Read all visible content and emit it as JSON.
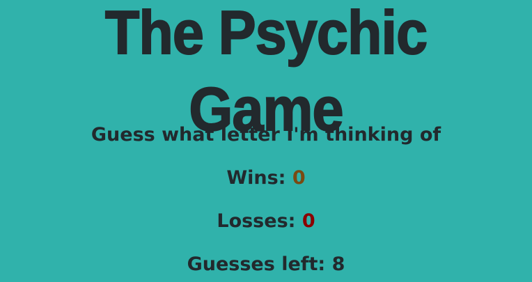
{
  "title": "The Psychic Game",
  "prompt": "Guess what letter I'm thinking of",
  "wins": {
    "label": "Wins:",
    "value": "0"
  },
  "losses": {
    "label": "Losses:",
    "value": "0"
  },
  "guesses_left": {
    "label": "Guesses left:",
    "value": "8"
  },
  "colors": {
    "background": "#30b2ab",
    "text": "#22292d",
    "wins_value": "#7a4a12",
    "losses_value": "#8b0000"
  }
}
